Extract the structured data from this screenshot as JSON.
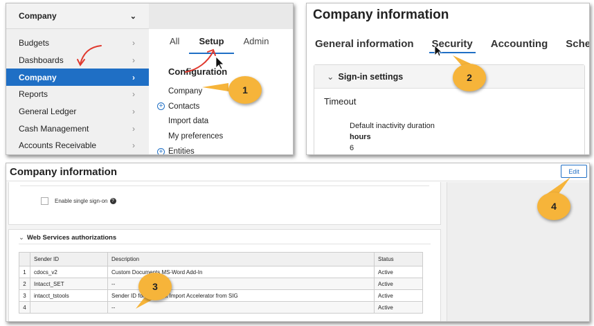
{
  "panel1": {
    "sidebar": {
      "header": "Company",
      "items": [
        {
          "label": "Budgets",
          "active": false
        },
        {
          "label": "Dashboards",
          "active": false
        },
        {
          "label": "Company",
          "active": true
        },
        {
          "label": "Reports",
          "active": false
        },
        {
          "label": "General Ledger",
          "active": false
        },
        {
          "label": "Cash Management",
          "active": false
        },
        {
          "label": "Accounts Receivable",
          "active": false
        }
      ]
    },
    "tabs": [
      "All",
      "Setup",
      "Admin"
    ],
    "selected_tab": "Setup",
    "section_title": "Configuration",
    "menu_items": [
      {
        "label": "Company",
        "expandable": false
      },
      {
        "label": "Contacts",
        "expandable": true
      },
      {
        "label": "Import data",
        "expandable": false
      },
      {
        "label": "My preferences",
        "expandable": false
      },
      {
        "label": "Entities",
        "expandable": true
      }
    ]
  },
  "panel2": {
    "title": "Company information",
    "tabs": [
      "General information",
      "Security",
      "Accounting",
      "Schedu"
    ],
    "selected_tab": "Security",
    "section": "Sign-in settings",
    "timeout_label": "Timeout",
    "duration_label": "Default inactivity duration",
    "duration_unit": "hours",
    "duration_value": "6"
  },
  "panel3": {
    "title": "Company information",
    "edit_label": "Edit",
    "sso_label": "Enable single sign-on",
    "sso_checked": false,
    "ws_section": "Web Services authorizations",
    "columns": [
      "",
      "Sender ID",
      "Description",
      "Status"
    ],
    "rows": [
      [
        "1",
        "cdocs_v2",
        "Custom Documents MS-Word Add-In",
        "Active"
      ],
      [
        "2",
        "Intacct_SET",
        "--",
        "Active"
      ],
      [
        "3",
        "intacct_tstools",
        "Sender ID for Payment Import Accelerator from SIG",
        "Active"
      ],
      [
        "4",
        "",
        "--",
        "Active"
      ]
    ]
  },
  "markers": [
    "1",
    "2",
    "3",
    "4"
  ],
  "colors": {
    "accent": "#1f6fc5",
    "marker": "#f6b43a",
    "annotation_red": "#e03a2f"
  },
  "icons": {
    "chevron": "chevron-right-icon",
    "collapse": "chevron-down-icon",
    "add": "plus-circle-icon",
    "help": "question-icon",
    "cursor": "mouse-pointer-icon"
  }
}
